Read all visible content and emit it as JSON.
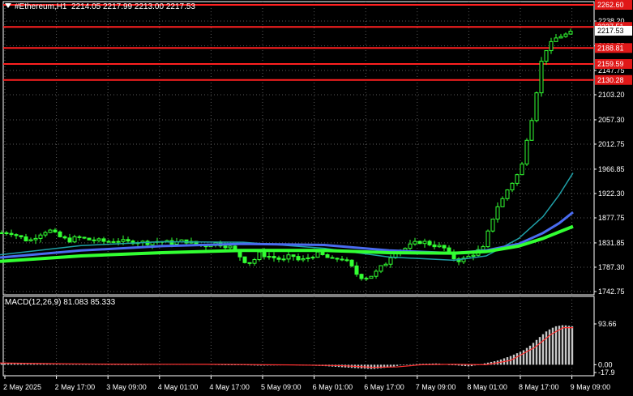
{
  "header": {
    "symbol": "#Ethereum,H1",
    "ohlc": "2214.05 2217.99 2213.00 2217.53"
  },
  "colors": {
    "background": "#000000",
    "axis": "#ffffff",
    "grid": "#5a5a5a",
    "candle": "#32ff32",
    "level_line": "#ff2020",
    "level_label_bg": "#e01818",
    "ma_fast": "#1fa0a8",
    "ma_mid": "#4a6cf0",
    "ma_slow": "#32ff32",
    "macd_hist": "#c8c8c8",
    "macd_signal": "#ff3030"
  },
  "chart_data": [
    {
      "type": "candlestick",
      "title": "#Ethereum,H1",
      "ohlc_last": [
        2214.05,
        2217.99,
        2213.0,
        2217.53
      ],
      "current_price": 2217.53,
      "x_tick_labels": [
        "2 May 2025",
        "2 May 17:00",
        "3 May 09:00",
        "4 May 01:00",
        "4 May 17:00",
        "5 May 09:00",
        "6 May 01:00",
        "6 May 17:00",
        "7 May 09:00",
        "8 May 01:00",
        "8 May 17:00",
        "9 May 09:00"
      ],
      "y_tick_labels": [
        "2238.20",
        "2192.75",
        "2147.75",
        "2103.20",
        "2057.30",
        "2012.75",
        "1966.85",
        "1922.30",
        "1877.75",
        "1831.85",
        "1787.30",
        "1742.75"
      ],
      "ylim": [
        1742.75,
        2262.6
      ],
      "levels": [
        "2262.60",
        "2227.51",
        "2188.81",
        "2159.59",
        "2130.28"
      ],
      "grid": true,
      "price_path": [
        [
          0,
          1850
        ],
        [
          12,
          1852
        ],
        [
          24,
          1843
        ],
        [
          36,
          1835
        ],
        [
          48,
          1848
        ],
        [
          60,
          1856
        ],
        [
          72,
          1844
        ],
        [
          84,
          1836
        ],
        [
          96,
          1842
        ],
        [
          108,
          1838
        ],
        [
          120,
          1836
        ],
        [
          132,
          1834
        ],
        [
          144,
          1837
        ],
        [
          156,
          1833
        ],
        [
          168,
          1835
        ],
        [
          180,
          1832
        ],
        [
          192,
          1835
        ],
        [
          204,
          1833
        ],
        [
          216,
          1832
        ],
        [
          228,
          1836
        ],
        [
          240,
          1830
        ],
        [
          252,
          1826
        ],
        [
          264,
          1832
        ],
        [
          276,
          1828
        ],
        [
          288,
          1822
        ],
        [
          300,
          1800
        ],
        [
          310,
          1795
        ],
        [
          320,
          1812
        ],
        [
          330,
          1808
        ],
        [
          340,
          1804
        ],
        [
          350,
          1800
        ],
        [
          360,
          1810
        ],
        [
          370,
          1798
        ],
        [
          380,
          1805
        ],
        [
          390,
          1812
        ],
        [
          400,
          1808
        ],
        [
          410,
          1800
        ],
        [
          420,
          1805
        ],
        [
          430,
          1795
        ],
        [
          440,
          1775
        ],
        [
          448,
          1768
        ],
        [
          456,
          1770
        ],
        [
          464,
          1778
        ],
        [
          472,
          1790
        ],
        [
          480,
          1800
        ],
        [
          484,
          1815
        ],
        [
          490,
          1818
        ],
        [
          500,
          1822
        ],
        [
          510,
          1830
        ],
        [
          520,
          1835
        ],
        [
          530,
          1830
        ],
        [
          540,
          1826
        ],
        [
          548,
          1822
        ],
        [
          556,
          1808
        ],
        [
          564,
          1800
        ],
        [
          572,
          1802
        ],
        [
          580,
          1808
        ],
        [
          588,
          1816
        ],
        [
          596,
          1822
        ],
        [
          604,
          1860
        ],
        [
          612,
          1895
        ],
        [
          620,
          1912
        ],
        [
          628,
          1935
        ],
        [
          636,
          1950
        ],
        [
          644,
          1975
        ],
        [
          652,
          2040
        ],
        [
          658,
          2070
        ],
        [
          664,
          2130
        ],
        [
          670,
          2180
        ],
        [
          676,
          2190
        ],
        [
          682,
          2200
        ],
        [
          688,
          2210
        ],
        [
          694,
          2212
        ],
        [
          700,
          2214
        ],
        [
          707,
          2217.53
        ]
      ],
      "indicators": [
        {
          "type": "ma",
          "path": [
            [
              0,
              1810
            ],
            [
              100,
              1827
            ],
            [
              200,
              1834
            ],
            [
              300,
              1833
            ],
            [
              400,
              1822
            ],
            [
              480,
              1806
            ],
            [
              560,
              1800
            ],
            [
              600,
              1808
            ],
            [
              640,
              1840
            ],
            [
              670,
              1880
            ],
            [
              690,
              1920
            ],
            [
              707,
              1960
            ]
          ]
        },
        {
          "type": "ma",
          "path": [
            [
              0,
              1805
            ],
            [
              100,
              1818
            ],
            [
              200,
              1826
            ],
            [
              300,
              1830
            ],
            [
              400,
              1828
            ],
            [
              480,
              1818
            ],
            [
              560,
              1813
            ],
            [
              600,
              1818
            ],
            [
              640,
              1830
            ],
            [
              670,
              1850
            ],
            [
              690,
              1868
            ],
            [
              707,
              1888
            ]
          ]
        },
        {
          "type": "ma",
          "path": [
            [
              0,
              1798
            ],
            [
              100,
              1808
            ],
            [
              200,
              1814
            ],
            [
              300,
              1818
            ],
            [
              400,
              1818
            ],
            [
              480,
              1814
            ],
            [
              560,
              1813
            ],
            [
              600,
              1816
            ],
            [
              640,
              1826
            ],
            [
              670,
              1840
            ],
            [
              690,
              1852
            ],
            [
              707,
              1862
            ]
          ]
        }
      ]
    },
    {
      "type": "bar",
      "title": "MACD(12,26,9) 81.083 85.333",
      "macd": 81.083,
      "signal": 85.333,
      "y_tick_labels": [
        "93.66",
        "0.00",
        "-17.9"
      ],
      "ylim": [
        -17.9,
        93.66
      ],
      "histogram": [
        [
          0,
          3
        ],
        [
          40,
          2
        ],
        [
          80,
          1
        ],
        [
          120,
          1
        ],
        [
          160,
          0.5
        ],
        [
          200,
          1
        ],
        [
          240,
          1.5
        ],
        [
          280,
          0
        ],
        [
          320,
          -2
        ],
        [
          360,
          -1
        ],
        [
          400,
          -3
        ],
        [
          440,
          -8
        ],
        [
          460,
          -10
        ],
        [
          480,
          -6
        ],
        [
          500,
          0.5
        ],
        [
          520,
          2
        ],
        [
          540,
          3
        ],
        [
          560,
          -1
        ],
        [
          580,
          -4
        ],
        [
          600,
          4
        ],
        [
          615,
          10
        ],
        [
          630,
          20
        ],
        [
          645,
          32
        ],
        [
          655,
          45
        ],
        [
          665,
          62
        ],
        [
          675,
          78
        ],
        [
          685,
          88
        ],
        [
          695,
          91
        ],
        [
          707,
          88
        ]
      ],
      "signal_path": [
        [
          0,
          4
        ],
        [
          60,
          2.5
        ],
        [
          120,
          1.5
        ],
        [
          200,
          1
        ],
        [
          280,
          0.8
        ],
        [
          360,
          -0.5
        ],
        [
          420,
          -2
        ],
        [
          460,
          -6
        ],
        [
          490,
          -5
        ],
        [
          520,
          0
        ],
        [
          560,
          1
        ],
        [
          600,
          0
        ],
        [
          630,
          10
        ],
        [
          660,
          40
        ],
        [
          680,
          70
        ],
        [
          695,
          85
        ],
        [
          707,
          85
        ]
      ]
    }
  ]
}
